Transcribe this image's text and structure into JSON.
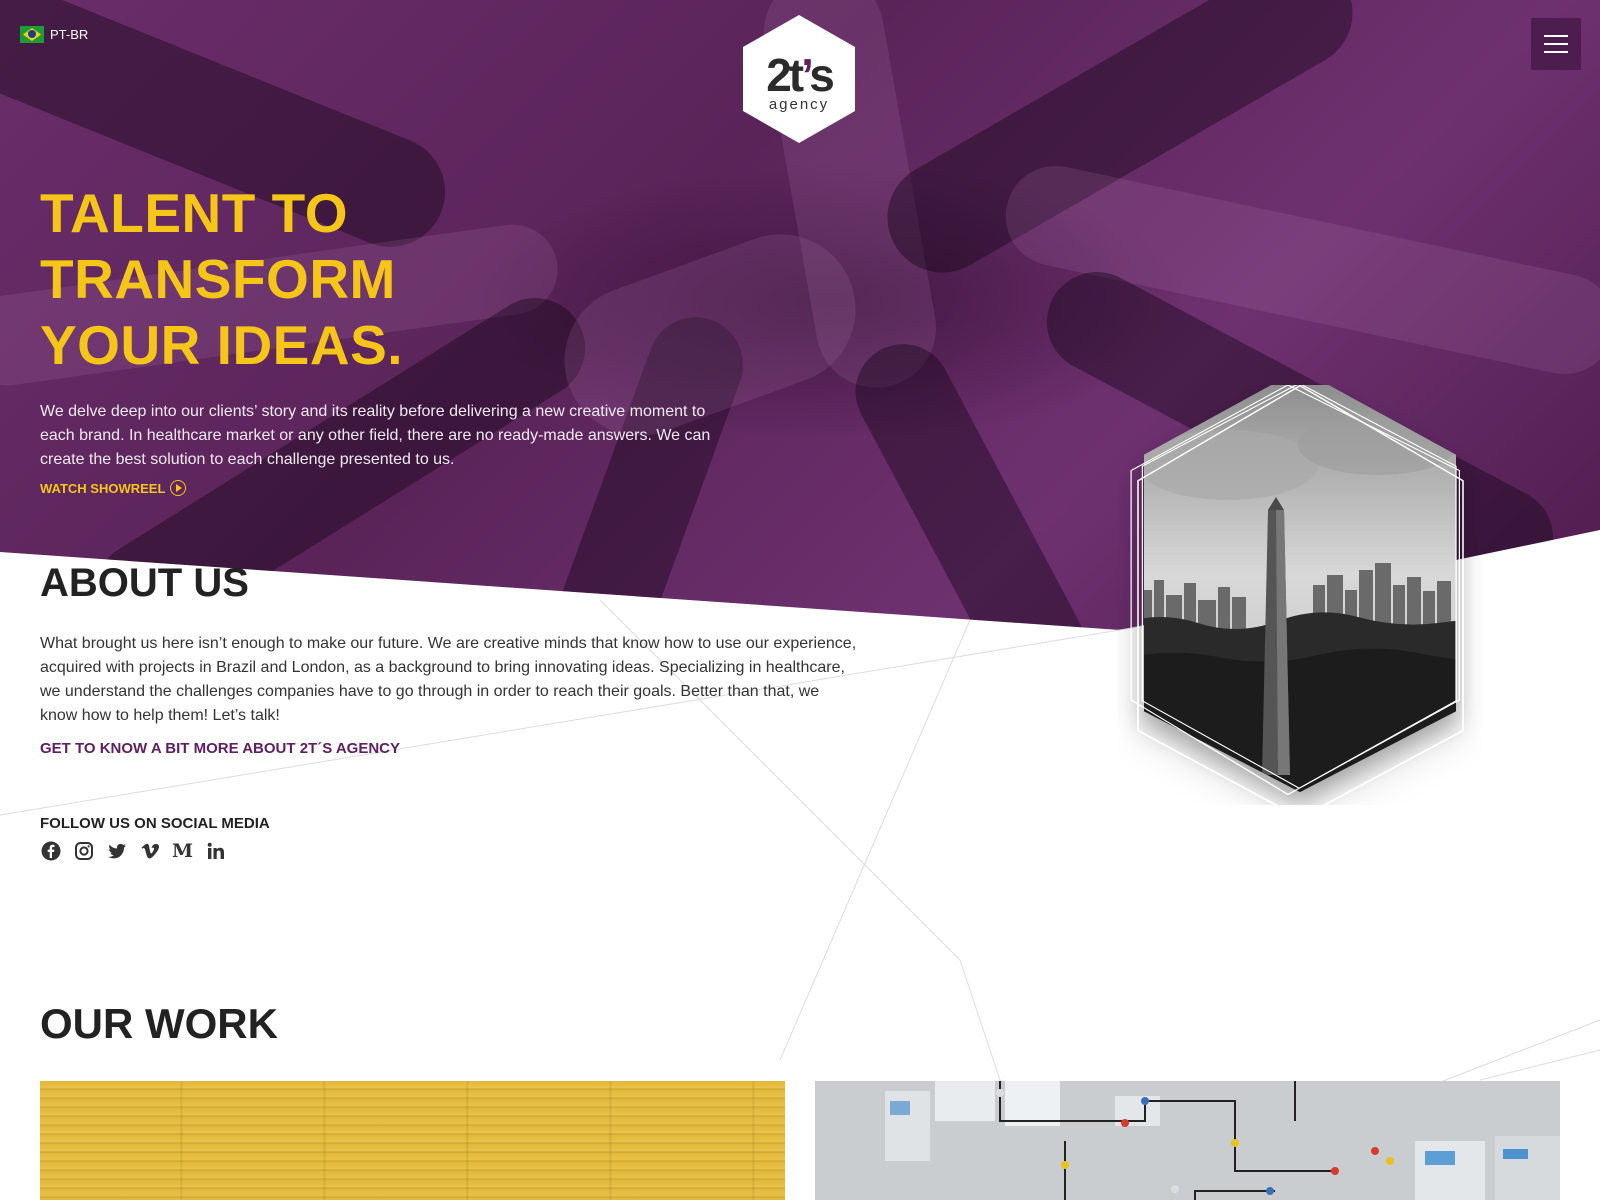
{
  "language": {
    "code": "PT-BR"
  },
  "logo": {
    "main": "2t’s",
    "sub": "agency"
  },
  "hero": {
    "title_lines": [
      "TALENT TO",
      "TRANSFORM",
      "YOUR IDEAS."
    ],
    "text": "We delve deep into our clients’ story and its reality before delivering a new creative moment to each brand. In healthcare market or any other field, there are no ready-made answers. We can create the best solution to each challenge presented to us.",
    "showreel_label": "WATCH SHOWREEL"
  },
  "about": {
    "title": "ABOUT US",
    "text": "What brought us here isn’t enough to make our future. We are creative minds that know how to use our experience, acquired with projects in Brazil and London, as a background to bring innovating ideas. Specializing in healthcare, we understand the challenges companies have to go through in order to reach their goals. Better than that, we know how to help them! Let’s talk!",
    "link_label": "GET TO KNOW A BIT MORE ABOUT 2T´S AGENCY"
  },
  "social": {
    "label": "FOLLOW US ON SOCIAL MEDIA",
    "icons": [
      "facebook-icon",
      "instagram-icon",
      "twitter-icon",
      "vimeo-icon",
      "medium-icon",
      "linkedin-icon"
    ]
  },
  "work": {
    "title": "OUR WORK"
  },
  "colors": {
    "brand_purple": "#5e2060",
    "accent_yellow": "#f5c518",
    "text_dark": "#222222"
  }
}
